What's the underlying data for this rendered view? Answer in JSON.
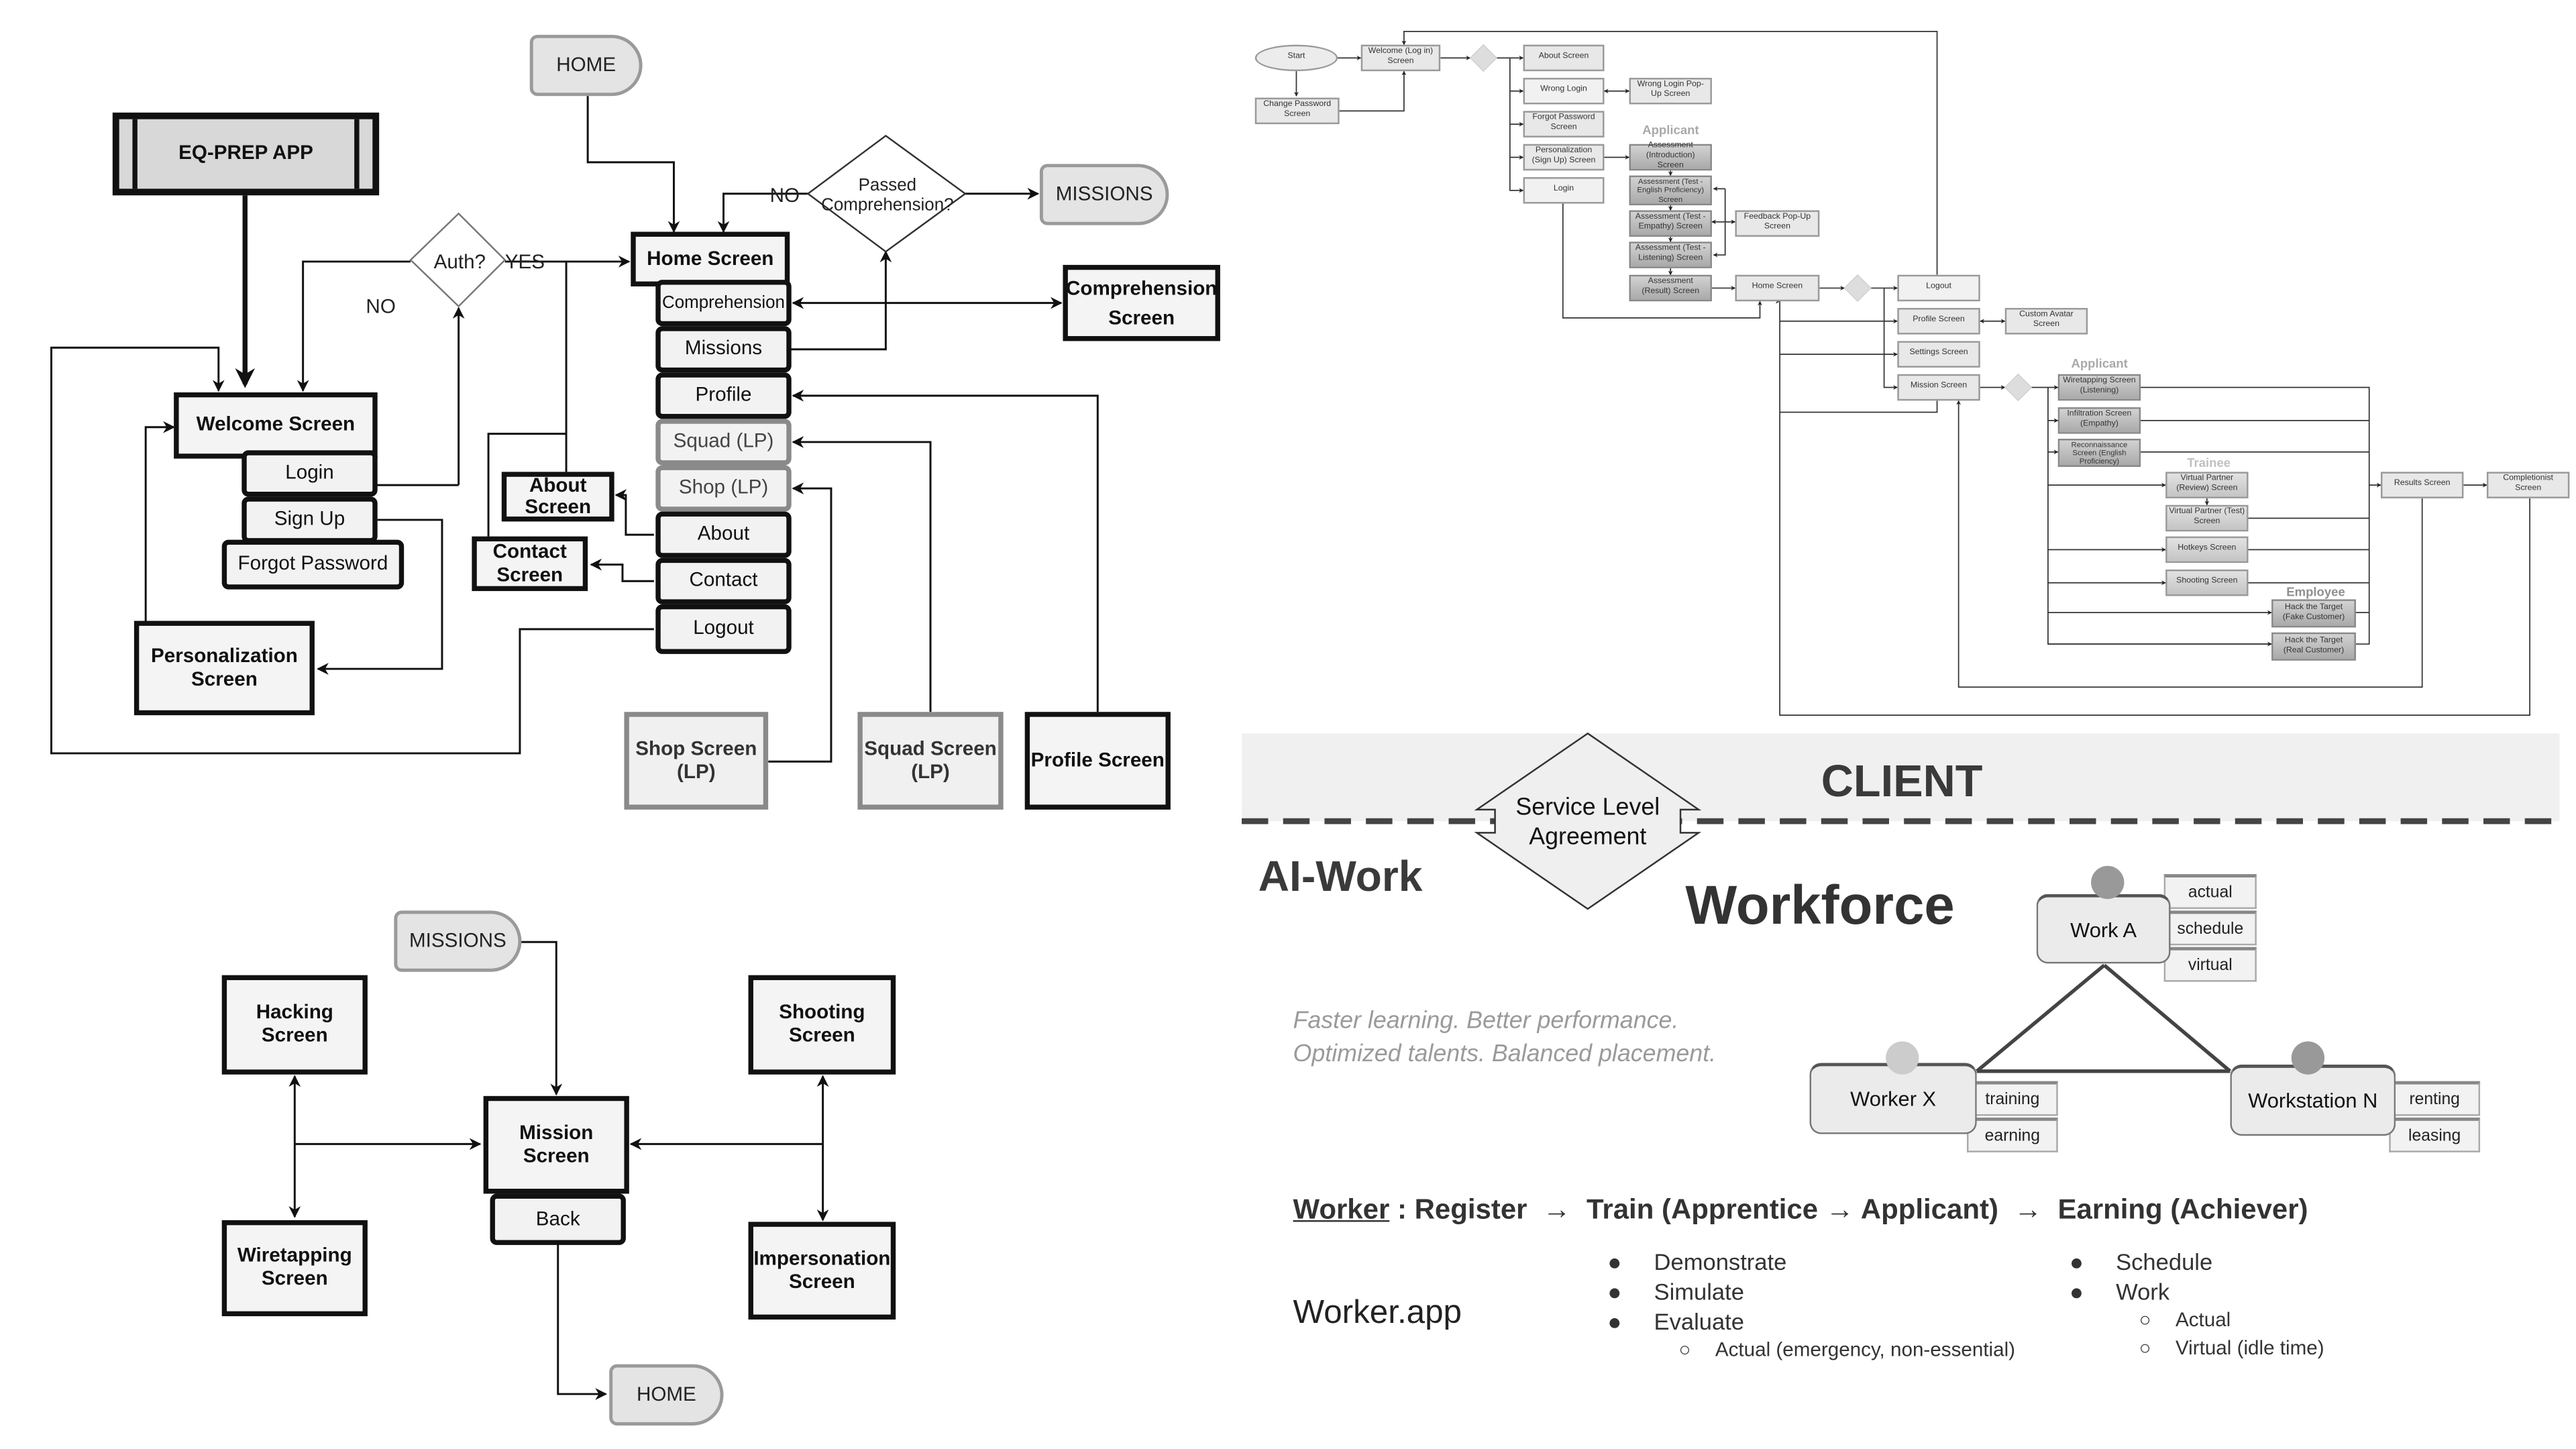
{
  "left_flow": {
    "app_title": "EQ-PREP APP",
    "home_terminal": "HOME",
    "missions_terminal": "MISSIONS",
    "auth_decision": "Auth?",
    "yes_label": "YES",
    "no_label": "NO",
    "passed_decision": "Passed Comprehension?",
    "passed_no_label": "NO",
    "welcome_screen": "Welcome Screen",
    "welcome_buttons": [
      "Login",
      "Sign Up",
      "Forgot Password"
    ],
    "personalization_screen": "Personalization Screen",
    "home_screen": "Home Screen",
    "home_buttons": [
      "Comprehension",
      "Missions",
      "Profile",
      "Squad (LP)",
      "Shop (LP)",
      "About",
      "Contact",
      "Logout"
    ],
    "about_screen": "About Screen",
    "contact_screen": "Contact Screen",
    "comprehension_screen": "Comprehension Screen",
    "shop_screen": "Shop Screen (LP)",
    "squad_screen": "Squad Screen (LP)",
    "profile_screen": "Profile Screen"
  },
  "mission_flow": {
    "missions_terminal": "MISSIONS",
    "home_terminal": "HOME",
    "mission_screen": "Mission Screen",
    "back_button": "Back",
    "hacking_screen": "Hacking Screen",
    "wiretapping_screen": "Wiretapping Screen",
    "shooting_screen": "Shooting Screen",
    "impersonation_screen": "Impersonation Screen"
  },
  "screen_map": {
    "start": "Start",
    "welcome": "Welcome (Log in) Screen",
    "change_password": "Change Password Screen",
    "about": "About Screen",
    "wrong_login": "Wrong Login",
    "wrong_login_popup": "Wrong Login Pop-Up Screen",
    "forgot_password": "Forgot Password Screen",
    "personalization": "Personalization (Sign Up) Screen",
    "login": "Login",
    "group_applicant": "Applicant",
    "assess_intro": "Assessment (Introduction) Screen",
    "assess_english": "Assessment (Test - English Proficiency) Screen",
    "assess_empathy": "Assessment (Test - Empathy) Screen",
    "assess_listening": "Assessment (Test - Listening) Screen",
    "assess_result": "Assessment (Result) Screen",
    "feedback_popup": "Feedback Pop-Up Screen",
    "home": "Home Screen",
    "logout": "Logout",
    "profile": "Profile Screen",
    "custom_avatar": "Custom Avatar Screen",
    "settings": "Settings Screen",
    "mission": "Mission Screen",
    "group_applicant2": "Applicant",
    "wiretapping": "Wiretapping Screen (Listening)",
    "infiltration": "Infiltration Screen (Empathy)",
    "reconnaissance": "Reconnaissance Screen (English Proficiency)",
    "group_trainee": "Trainee",
    "vp_review": "Virtual Partner (Review) Screen",
    "vp_test": "Virtual Partner (Test) Screen",
    "hotkeys": "Hotkeys Screen",
    "shooting": "Shooting Screen",
    "group_employee": "Employee",
    "hack_fake": "Hack the Target (Fake Customer)",
    "hack_real": "Hack the Target (Real Customer)",
    "results": "Results Screen",
    "completionist": "Completionist Screen"
  },
  "workforce": {
    "client_label": "CLIENT",
    "sla_label": "Service Level Agreement",
    "aiwork_label": "AI-Work",
    "workforce_label": "Workforce",
    "tagline_1": "Faster learning. Better performance.",
    "tagline_2": "Optimized talents. Balanced placement.",
    "work_node": "Work A",
    "work_tags": [
      "actual",
      "schedule",
      "virtual"
    ],
    "worker_node": "Worker X",
    "worker_tags": [
      "training",
      "earning"
    ],
    "station_node": "Workstation N",
    "station_tags": [
      "renting",
      "leasing"
    ],
    "pipeline_head": "Worker",
    "pipeline_rest": " : Register  →  Train (Apprentice → Applicant)  →  Earning (Achiever)",
    "app_label": "Worker.app",
    "left_bullets": [
      "Demonstrate",
      "Simulate",
      "Evaluate"
    ],
    "left_sub": [
      "Actual (emergency, non-essential)"
    ],
    "right_bullets": [
      "Schedule",
      "Work"
    ],
    "right_sub": [
      "Actual",
      "Virtual (idle time)"
    ],
    "colors": {
      "dot_dark": "#999999",
      "dot_light": "#cccccc",
      "band": "#f0f0f0",
      "dash": "#444444"
    }
  }
}
